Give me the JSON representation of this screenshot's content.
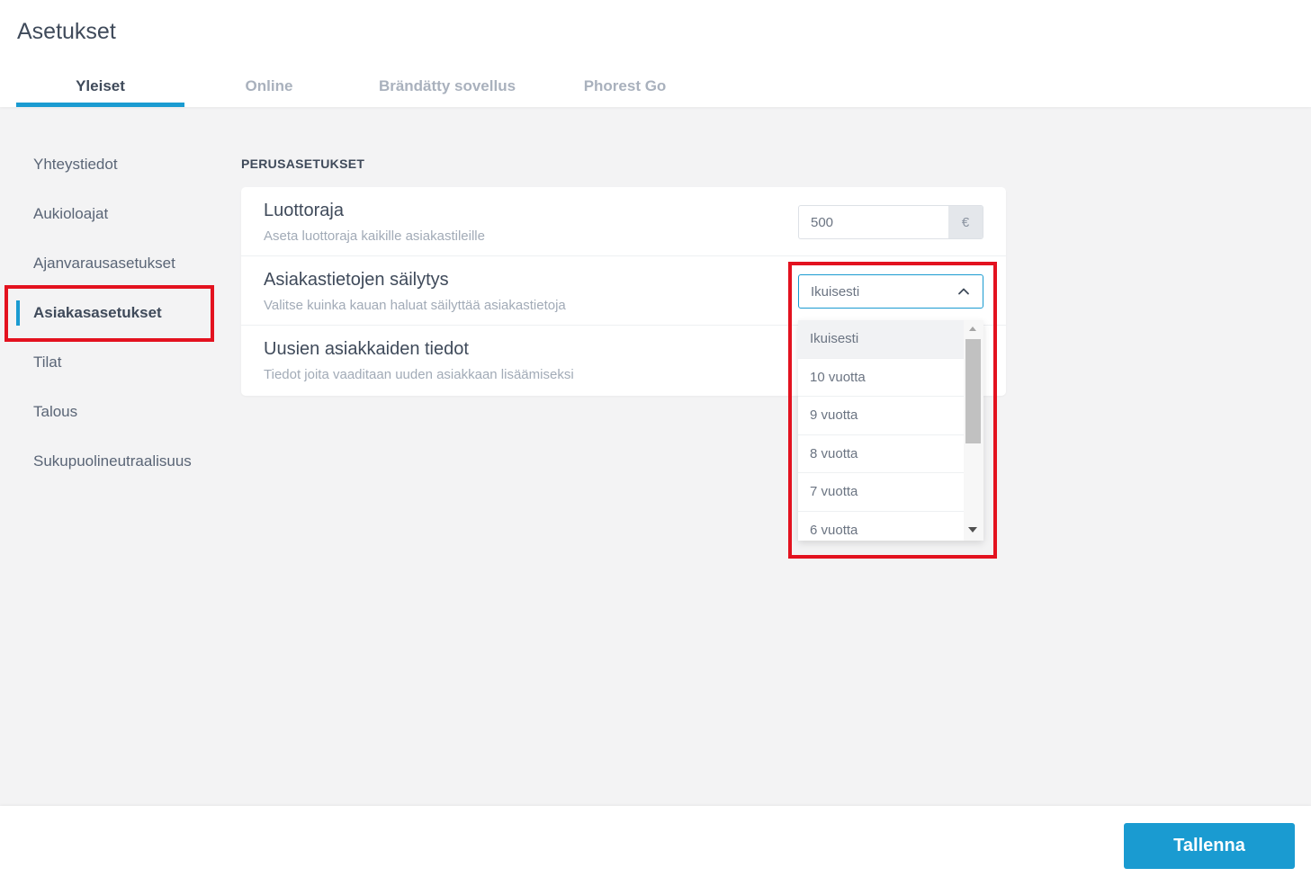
{
  "header": {
    "title": "Asetukset",
    "tabs": [
      {
        "label": "Yleiset",
        "active": true
      },
      {
        "label": "Online"
      },
      {
        "label": "Brändätty sovellus"
      },
      {
        "label": "Phorest Go"
      }
    ]
  },
  "sidebar": {
    "items": [
      {
        "label": "Yhteystiedot"
      },
      {
        "label": "Aukioloajat"
      },
      {
        "label": "Ajanvarausasetukset"
      },
      {
        "label": "Asiakasasetukset",
        "active": true
      },
      {
        "label": "Tilat"
      },
      {
        "label": "Talous"
      },
      {
        "label": "Sukupuolineutraalisuus"
      }
    ]
  },
  "main": {
    "section_title": "PERUSASETUKSET",
    "credit_limit": {
      "title": "Luottoraja",
      "description": "Aseta luottoraja kaikille asiakastileille",
      "value": "500",
      "unit": "€"
    },
    "retention": {
      "title": "Asiakastietojen säilytys",
      "description": "Valitse kuinka kauan haluat säilyttää asiakastietoja",
      "selected": "Ikuisesti",
      "options": [
        "Ikuisesti",
        "10 vuotta",
        "9 vuotta",
        "8 vuotta",
        "7 vuotta",
        "6 vuotta"
      ]
    },
    "new_clients": {
      "title": "Uusien asiakkaiden tiedot",
      "description": "Tiedot joita vaaditaan uuden asiakkaan lisäämiseksi"
    }
  },
  "footer": {
    "save_label": "Tallenna"
  },
  "colors": {
    "accent": "#1a9bd1",
    "highlight": "#e3121f"
  }
}
